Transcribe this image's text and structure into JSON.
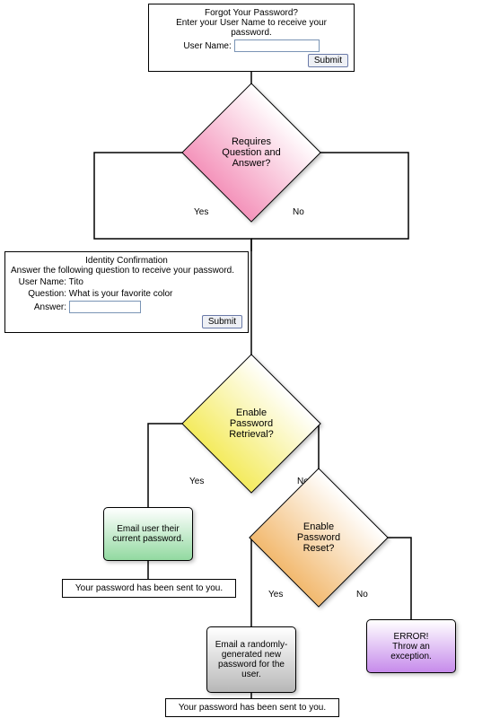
{
  "forgot": {
    "title": "Forgot Your Password?",
    "prompt": "Enter your User Name to receive your password.",
    "username_label": "User Name:",
    "username_value": "",
    "submit": "Submit"
  },
  "decision1": "Requires Question and Answer?",
  "branch1_yes": "Yes",
  "branch1_no": "No",
  "identity": {
    "title": "Identity Confirmation",
    "prompt": "Answer the following question to receive your password.",
    "username_label": "User Name:",
    "username_value": "Tito",
    "question_label": "Question:",
    "question_value": "What is your favorite color",
    "answer_label": "Answer:",
    "answer_value": "",
    "submit": "Submit"
  },
  "decision2": "Enable Password Retrieval?",
  "branch2_yes": "Yes",
  "branch2_no": "No",
  "action_email_current": "Email user their current password.",
  "result1": "Your password has been sent to you.",
  "decision3": "Enable Password Reset?",
  "branch3_yes": "Yes",
  "branch3_no": "No",
  "action_email_new": "Email a randomly-generated new password for the user.",
  "action_error_line1": "ERROR!",
  "action_error_line2": "Throw an exception.",
  "result2": "Your password has been sent to you."
}
